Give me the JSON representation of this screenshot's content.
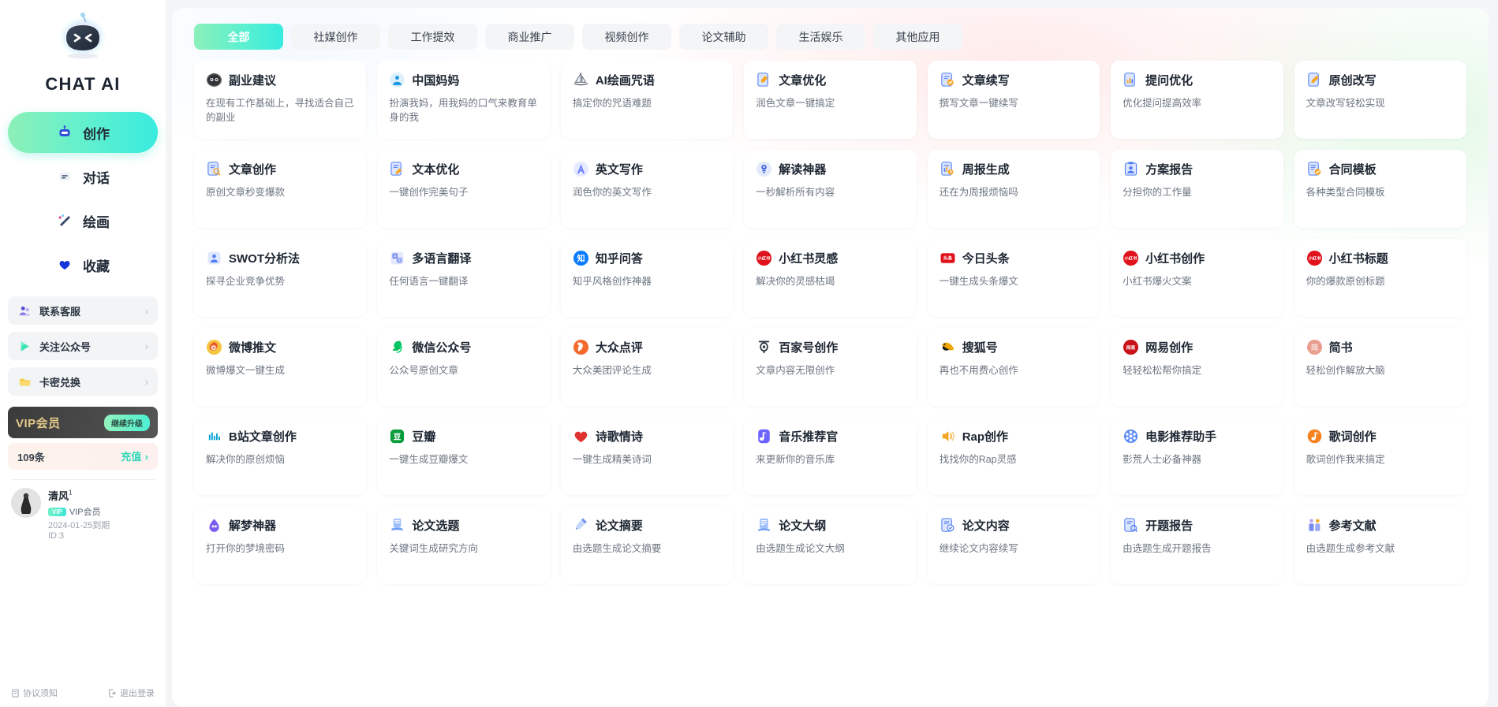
{
  "brand": {
    "title": "CHAT AI",
    "logo_icon": "robot-logo-icon"
  },
  "sidebar": {
    "nav": [
      {
        "label": "创作",
        "icon": "robot-icon",
        "active": true
      },
      {
        "label": "对话",
        "icon": "chat-bubble-icon",
        "active": false
      },
      {
        "label": "绘画",
        "icon": "paint-brush-icon",
        "active": false
      },
      {
        "label": "收藏",
        "icon": "heart-icon",
        "active": false
      }
    ],
    "utils": [
      {
        "label": "联系客服",
        "icon": "customer-service-icon",
        "chevron": "›"
      },
      {
        "label": "关注公众号",
        "icon": "play-triangle-icon",
        "chevron": "›"
      },
      {
        "label": "卡密兑换",
        "icon": "wallet-icon",
        "chevron": "›"
      }
    ],
    "vip": {
      "label": "VIP会员",
      "button": "继续升级"
    },
    "quota": {
      "count": "109条",
      "action": "充值",
      "chevron": "›"
    },
    "profile": {
      "name": "清风",
      "level_sup": "1",
      "badge": "VIP",
      "membership": "VIP会员",
      "expiry": "2024-01-25到期",
      "id": "ID:3",
      "avatar_icon": "user-avatar"
    },
    "footer": [
      {
        "label": "协议须知",
        "icon": "document-icon"
      },
      {
        "label": "退出登录",
        "icon": "logout-icon"
      }
    ]
  },
  "main": {
    "tabs": [
      {
        "label": "全部",
        "active": true
      },
      {
        "label": "社媒创作",
        "active": false
      },
      {
        "label": "工作提效",
        "active": false
      },
      {
        "label": "商业推广",
        "active": false
      },
      {
        "label": "视频创作",
        "active": false
      },
      {
        "label": "论文辅助",
        "active": false
      },
      {
        "label": "生活娱乐",
        "active": false
      },
      {
        "label": "其他应用",
        "active": false
      }
    ],
    "cards": [
      {
        "title": "副业建议",
        "desc": "在现有工作基础上，寻找适合自己的副业",
        "icon": "panda-face-icon",
        "color": "#4d4f52"
      },
      {
        "title": "中国妈妈",
        "desc": "扮演我妈，用我妈的口气来教育单身的我",
        "icon": "person-circle-icon",
        "color": "#1e9ae0"
      },
      {
        "title": "AI绘画咒语",
        "desc": "搞定你的咒语难题",
        "icon": "sailboat-icon",
        "color": "#5a6472"
      },
      {
        "title": "文章优化",
        "desc": "润色文章一键搞定",
        "icon": "pencil-doc-icon",
        "color": "#4f7df3"
      },
      {
        "title": "文章续写",
        "desc": "撰写文章一键续写",
        "icon": "doc-check-icon",
        "color": "#4f7df3"
      },
      {
        "title": "提问优化",
        "desc": "优化提问提高效率",
        "icon": "doc-chart-icon",
        "color": "#4f7df3"
      },
      {
        "title": "原创改写",
        "desc": "文章改写轻松实现",
        "icon": "doc-edit-icon",
        "color": "#4f7df3"
      },
      {
        "title": "文章创作",
        "desc": "原创文章秒变爆款",
        "icon": "doc-search-icon",
        "color": "#4f7df3"
      },
      {
        "title": "文本优化",
        "desc": "一键创作完美句子",
        "icon": "doc-pen-icon",
        "color": "#4f7df3"
      },
      {
        "title": "英文写作",
        "desc": "润色你的英文写作",
        "icon": "letter-a-icon",
        "color": "#6f7dff"
      },
      {
        "title": "解读神器",
        "desc": "一秒解析所有内容",
        "icon": "lamp-icon",
        "color": "#3f63d8"
      },
      {
        "title": "周报生成",
        "desc": "还在为周报烦恼吗",
        "icon": "report-icon",
        "color": "#4f7df3"
      },
      {
        "title": "方案报告",
        "desc": "分担你的工作量",
        "icon": "clipboard-user-icon",
        "color": "#4f7df3"
      },
      {
        "title": "合同模板",
        "desc": "各种类型合同模板",
        "icon": "contract-icon",
        "color": "#4f7df3"
      },
      {
        "title": "SWOT分析法",
        "desc": "探寻企业竞争优势",
        "icon": "analysis-icon",
        "color": "#4f7df3"
      },
      {
        "title": "多语言翻译",
        "desc": "任何语言一键翻译",
        "icon": "translate-icon",
        "color": "#7b8cf0"
      },
      {
        "title": "知乎问答",
        "desc": "知乎风格创作神器",
        "icon": "zhihu-icon",
        "color": "#0a7cff"
      },
      {
        "title": "小红书灵感",
        "desc": "解决你的灵感枯竭",
        "icon": "xiaohongshu-icon",
        "color": "#e0121c"
      },
      {
        "title": "今日头条",
        "desc": "一键生成头条爆文",
        "icon": "toutiao-icon",
        "color": "#e0121c"
      },
      {
        "title": "小红书创作",
        "desc": "小红书爆火文案",
        "icon": "xiaohongshu-icon",
        "color": "#e0121c"
      },
      {
        "title": "小红书标题",
        "desc": "你的爆款原创标题",
        "icon": "xiaohongshu-icon",
        "color": "#e0121c"
      },
      {
        "title": "微博推文",
        "desc": "微博爆文一键生成",
        "icon": "weibo-icon",
        "color": "#f5a623"
      },
      {
        "title": "微信公众号",
        "desc": "公众号原创文章",
        "icon": "wechat-icon",
        "color": "#07c160"
      },
      {
        "title": "大众点评",
        "desc": "大众美团评论生成",
        "icon": "dianping-icon",
        "color": "#f56a2c"
      },
      {
        "title": "百家号创作",
        "desc": "文章内容无限创作",
        "icon": "baijiahao-icon",
        "color": "#2b3340"
      },
      {
        "title": "搜狐号",
        "desc": "再也不用费心创作",
        "icon": "sohu-icon",
        "color": "#f0a500"
      },
      {
        "title": "网易创作",
        "desc": "轻轻松松帮你搞定",
        "icon": "netease-icon",
        "color": "#c8131a"
      },
      {
        "title": "简书",
        "desc": "轻松创作解放大脑",
        "icon": "jianshu-icon",
        "color": "#ea9e8e"
      },
      {
        "title": "B站文章创作",
        "desc": "解决你的原创烦恼",
        "icon": "bilibili-icon",
        "color": "#00a1d6"
      },
      {
        "title": "豆瓣",
        "desc": "一键生成豆瓣爆文",
        "icon": "douban-icon",
        "color": "#0a9d3c"
      },
      {
        "title": "诗歌情诗",
        "desc": "一键生成精美诗词",
        "icon": "heart-red-icon",
        "color": "#e03131"
      },
      {
        "title": "音乐推荐官",
        "desc": "来更新你的音乐库",
        "icon": "music-app-icon",
        "color": "#6c63ff"
      },
      {
        "title": "Rap创作",
        "desc": "找找你的Rap灵感",
        "icon": "speaker-icon",
        "color": "#f5a623"
      },
      {
        "title": "电影推荐助手",
        "desc": "影荒人士必备神器",
        "icon": "film-reel-icon",
        "color": "#4f7df3"
      },
      {
        "title": "歌词创作",
        "desc": "歌词创作我来搞定",
        "icon": "music-note-icon",
        "color": "#f5821f"
      },
      {
        "title": "解梦神器",
        "desc": "打开你的梦境密码",
        "icon": "dream-icon",
        "color": "#7b5cf0"
      },
      {
        "title": "论文选题",
        "desc": "关键词生成研究方向",
        "icon": "thesis-topic-icon",
        "color": "#4f7df3"
      },
      {
        "title": "论文摘要",
        "desc": "由选题生成论文摘要",
        "icon": "thesis-abstract-icon",
        "color": "#6f8cf3"
      },
      {
        "title": "论文大纲",
        "desc": "由选题生成论文大纲",
        "icon": "thesis-outline-icon",
        "color": "#4f7df3"
      },
      {
        "title": "论文内容",
        "desc": "继续论文内容续写",
        "icon": "thesis-content-icon",
        "color": "#4f7df3"
      },
      {
        "title": "开题报告",
        "desc": "由选题生成开题报告",
        "icon": "thesis-proposal-icon",
        "color": "#4f7df3"
      },
      {
        "title": "参考文献",
        "desc": "由选题生成参考文献",
        "icon": "thesis-reference-icon",
        "color": "#7b8cf0"
      }
    ]
  },
  "colors": {
    "accent_gradient_start": "#8cf0b9",
    "accent_gradient_end": "#38ebdf",
    "panel_bg": "#ffffff",
    "app_bg": "#f3f5f7",
    "vip_gold": "#e4c98a"
  }
}
